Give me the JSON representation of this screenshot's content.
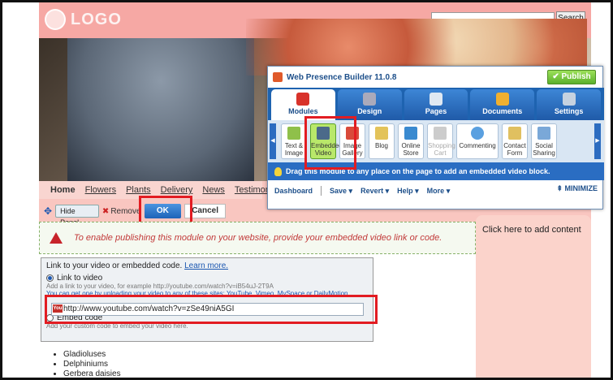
{
  "header": {
    "logo_text": "LOGO",
    "search_button": "Search",
    "search_value": ""
  },
  "nav": {
    "items": [
      "Home",
      "Flowers",
      "Plants",
      "Delivery",
      "News",
      "Testimonial"
    ]
  },
  "toolbar": {
    "hide_panel": "Hide Panel",
    "remove": "Remove",
    "ok": "OK",
    "cancel": "Cancel"
  },
  "warning": {
    "text": "To enable publishing this module on your website, provide your embedded video link or code."
  },
  "right_panel": {
    "text": "Click here to add content"
  },
  "video_panel": {
    "heading": "Link to your video or embedded code.",
    "learn_more": "Learn more.",
    "option1": "Link to video",
    "hint1": "Add a link to your video, for example http://youtube.com/watch?v=iB54uJ-2T9A",
    "hint2": "You can get one by uploading your video to any of these sites: YouTube, Vimeo, MySpace or DailyMotion",
    "url_value": "http://www.youtube.com/watch?v=zSe49niA5GI",
    "option2": "Embed code",
    "hint3": "Add your custom code to embed your video here."
  },
  "list": {
    "items": [
      "Gladioluses",
      "Delphiniums",
      "Gerbera daisies"
    ]
  },
  "wpb": {
    "title": "Web Presence Builder 11.0.8",
    "publish": "Publish",
    "tabs": [
      "Modules",
      "Design",
      "Pages",
      "Documents",
      "Settings"
    ],
    "modules": [
      "Text & Image",
      "Embedded Video",
      "Image Gallery",
      "Blog",
      "Online Store",
      "Shopping Cart",
      "Commenting",
      "Contact Form",
      "Social Sharing"
    ],
    "tip": "Drag this module to any place on the page to add an embedded video block.",
    "bottom": [
      "Dashboard",
      "Save",
      "Revert",
      "Help",
      "More"
    ],
    "minimize": "MINIMIZE"
  }
}
